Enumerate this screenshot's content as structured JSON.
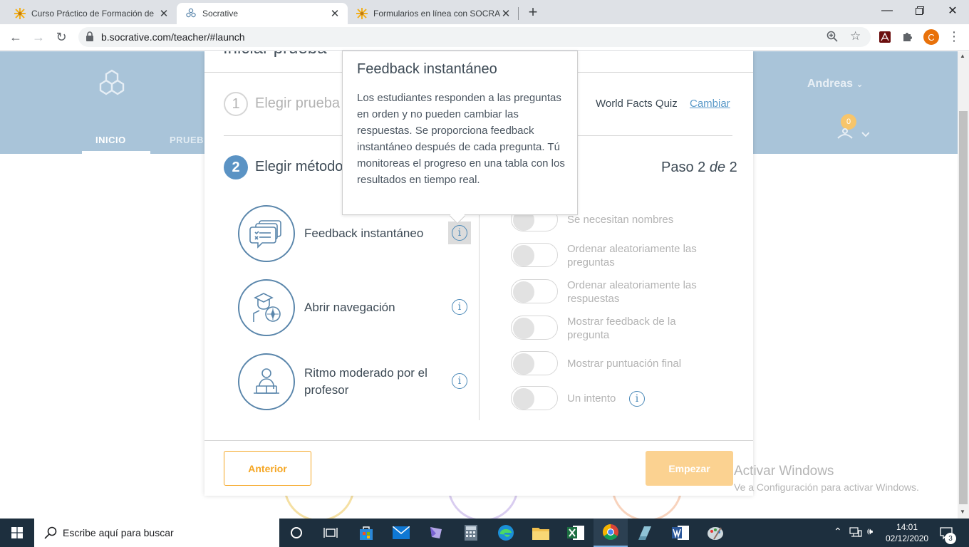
{
  "browser": {
    "tabs": [
      {
        "title": "Curso Práctico de Formación de ",
        "icon": "sunflower-icon",
        "active": false
      },
      {
        "title": "Socrative",
        "icon": "socrative-icon",
        "active": true
      },
      {
        "title": "Formularios en línea con SOCRAT",
        "icon": "sunflower-icon",
        "active": false
      }
    ],
    "url": "b.socrative.com/teacher/#launch",
    "profile_initial": "C"
  },
  "hero": {
    "nav_home": "INICIO",
    "nav_quizzes": "PRUEB",
    "user_name": "Andreas",
    "rooms_badge": "0"
  },
  "modal": {
    "header_partial": "Iniciar prueba",
    "step1": {
      "number": "1",
      "label": "Elegir prueba",
      "selected_quiz": "World Facts Quiz",
      "change_link": "Cambiar"
    },
    "step2": {
      "number": "2",
      "label": "Elegir método",
      "progress_prefix": "Paso 2",
      "progress_of": "de",
      "progress_total": "2"
    },
    "methods": [
      {
        "label": "Feedback instantáneo",
        "icon": "chat-bubbles-icon"
      },
      {
        "label": "Abrir navegación",
        "icon": "graduate-compass-icon"
      },
      {
        "label": "Ritmo moderado por el profesor",
        "icon": "teacher-icon"
      }
    ],
    "options": [
      {
        "label": "Se necesitan nombres",
        "on": false
      },
      {
        "label": "Ordenar aleatoriamente las preguntas",
        "on": false
      },
      {
        "label": "Ordenar aleatoriamente las respuestas",
        "on": false
      },
      {
        "label": "Mostrar feedback de la pregunta",
        "on": false
      },
      {
        "label": "Mostrar puntuación final",
        "on": false
      },
      {
        "label": "Un intento",
        "on": false
      }
    ],
    "back_button": "Anterior",
    "start_button": "Empezar"
  },
  "tooltip": {
    "title": "Feedback instantáneo",
    "body": "Los estudiantes responden a las preguntas en orden y no pueden cambiar las respuestas. Se proporciona feedback instantáneo después de cada pregunta. Tú monitoreas el progreso en una tabla con los resultados en tiempo real."
  },
  "watermark": {
    "title": "Activar Windows",
    "subtitle": "Ve a Configuración para activar Windows."
  },
  "taskbar": {
    "search_placeholder": "Escribe aquí para buscar",
    "time": "14:01",
    "date": "02/12/2020",
    "notifications": "3"
  },
  "colors": {
    "accent_orange": "#f5a623",
    "start_disabled": "#fbd291",
    "hero_blue": "#a9c4d9",
    "icon_blue": "#5a86ab",
    "link_blue": "#4b89b8"
  }
}
